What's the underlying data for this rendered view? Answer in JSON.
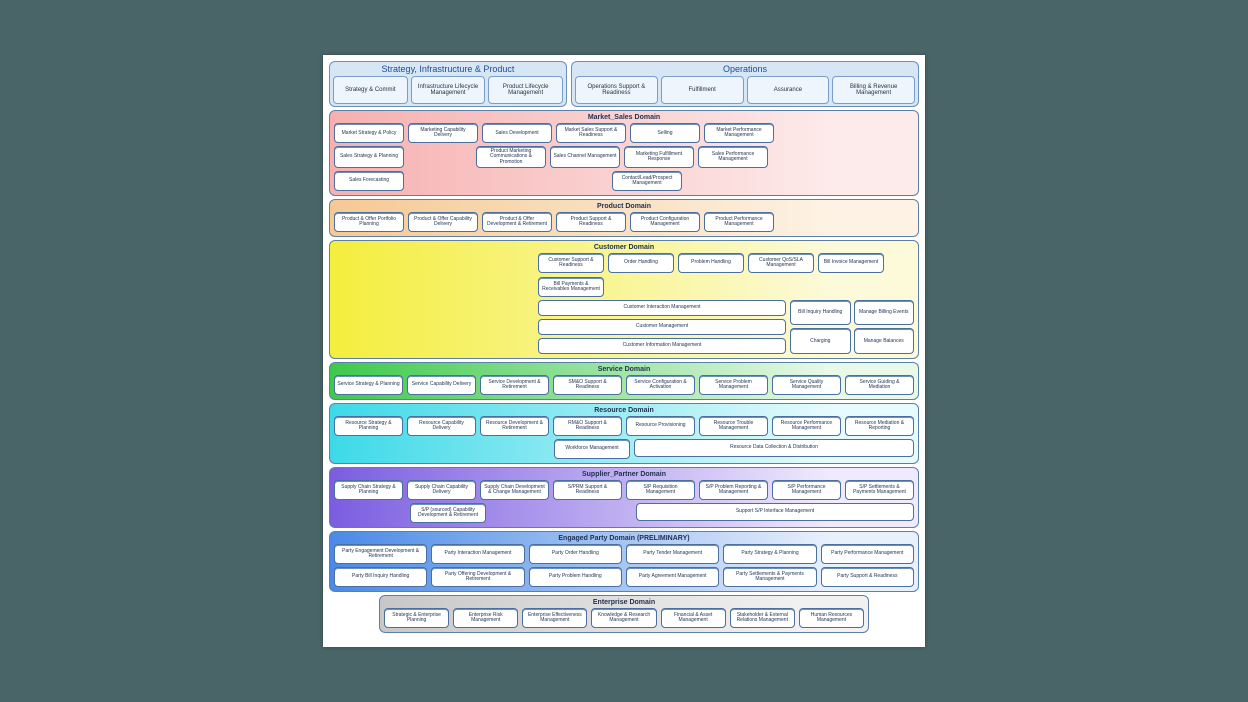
{
  "top": {
    "sip": {
      "title": "Strategy, Infrastructure & Product",
      "cols": [
        "Strategy & Commit",
        "Infrastructure Lifecycle Management",
        "Product Lifecycle Management"
      ]
    },
    "ops": {
      "title": "Operations",
      "cols": [
        "Operations Support & Readiness",
        "Fulfillment",
        "Assurance",
        "Billing & Revenue Management"
      ]
    }
  },
  "domains": {
    "market": {
      "title": "Market_Sales Domain",
      "r1": [
        "Market Strategy & Policy",
        "Marketing Capability Delivery",
        "Sales Development",
        "Market Sales Support & Readiness",
        "Selling",
        "Market Performance Management"
      ],
      "r2": [
        "Sales Strategy & Planning",
        "Product Marketing Communications & Promotion",
        "Sales Channel Management",
        "Marketing Fulfillment Response",
        "Sales Performance Management"
      ],
      "r3": [
        "Sales Forecasting",
        "Contact/Lead/Prospect Management"
      ]
    },
    "product": {
      "title": "Product Domain",
      "r1": [
        "Product & Offer Portfolio Planning",
        "Product & Offer Capability Delivery",
        "Product & Offer Development & Retirement",
        "Product Support & Readiness",
        "Product Configuration Management",
        "Product Performance Management"
      ]
    },
    "customer": {
      "title": "Customer Domain",
      "r1": [
        "Customer Support & Readiness",
        "Order Handling",
        "Problem Handling",
        "Customer QoS/SLA Management",
        "Bill Invoice Management",
        "Bill Payments & Receivables Management"
      ],
      "wide": [
        "Customer Interaction Management",
        "Customer Management",
        "Customer Information Management"
      ],
      "side": [
        "Bill Inquiry Handling",
        "Manage Billing Events",
        "Charging",
        "Manage Balances"
      ]
    },
    "service": {
      "title": "Service Domain",
      "r1": [
        "Service Strategy & Planning",
        "Service Capability Delivery",
        "Service Development & Retirement",
        "SM&O Support & Readiness",
        "Service Configuration & Activation",
        "Service Problem Management",
        "Service Quality Management",
        "Service Guiding & Mediation"
      ]
    },
    "resource": {
      "title": "Resource Domain",
      "r1": [
        "Resource Strategy & Planning",
        "Resource Capability Delivery",
        "Resource Development & Retirement",
        "RM&O Support & Readiness",
        "Resource Provisioning",
        "Resource Trouble Management",
        "Resource Performance Management",
        "Resource Mediation & Reporting"
      ],
      "r2a": "Workforce Management",
      "r2b": "Resource Data Collection & Distribution"
    },
    "supplier": {
      "title": "Supplier_Partner Domain",
      "r1": [
        "Supply Chain Strategy & Planning",
        "Supply Chain Capability Delivery",
        "Supply Chain Development & Change Management",
        "S/PRM Support & Readiness",
        "S/P Requisition Management",
        "S/P Problem Reporting & Management",
        "S/P Performance Management",
        "S/P Settlements & Payments Management"
      ],
      "r2a": "S/P (sourced) Capability Development & Retirement",
      "r2b": "Support S/P Interface Management"
    },
    "engaged": {
      "title": "Engaged Party Domain (PRELIMINARY)",
      "r1": [
        "Party Engagement Development & Retirement",
        "Party Interaction Management",
        "Party Order Handling",
        "Party Tender Management",
        "Party Strategy & Planning",
        "Party Performance Management"
      ],
      "r2": [
        "Party Bill Inquiry Handling",
        "Party Offering Development & Retirement",
        "Party Problem Handling",
        "Party Agreement Management",
        "Party Settlements & Payments Management",
        "Party Support & Readiness"
      ]
    },
    "enterprise": {
      "title": "Enterprise Domain",
      "r1": [
        "Strategic & Enterprise Planning",
        "Enterprise Risk Management",
        "Enterprise Effectiveness Management",
        "Knowledge & Research Management",
        "Financial & Asset Management",
        "Stakeholder & External Relations Management",
        "Human Resources Management"
      ]
    }
  }
}
